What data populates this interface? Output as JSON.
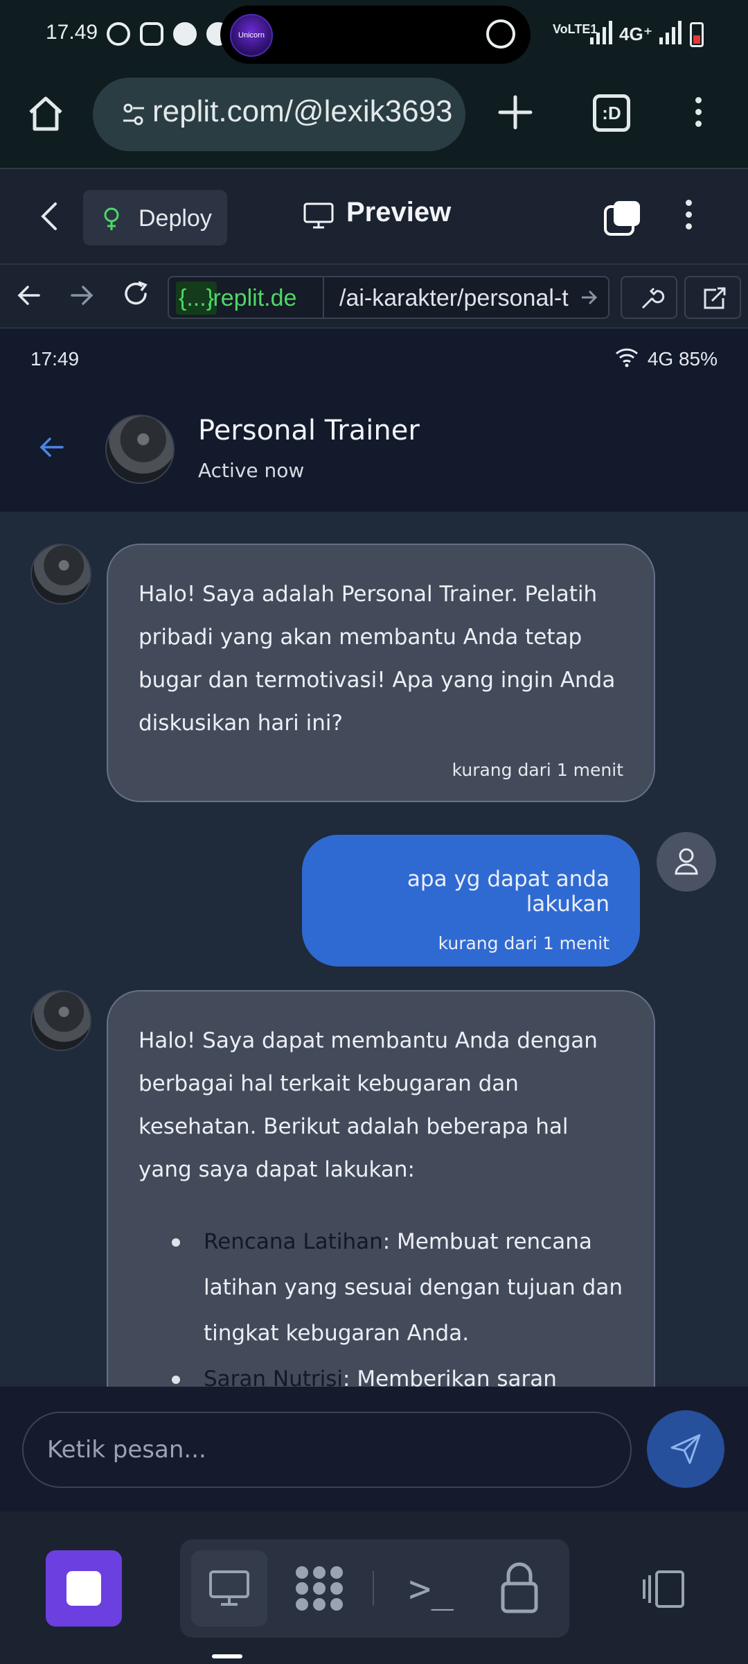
{
  "system": {
    "time": "17.49",
    "network_label": "VoLTE1",
    "network_type": "4G⁺",
    "camera_label": "Unicorn"
  },
  "browser": {
    "url": "replit.com/@lexik3693",
    "tabs_label": ":D"
  },
  "replit": {
    "deploy_label": "Deploy",
    "preview_label": "Preview"
  },
  "webview": {
    "domain_badge": "{...}",
    "domain": ".replit.de",
    "path": "/ai-karakter/personal-t"
  },
  "app_status": {
    "time": "17:49",
    "right": "4G 85%"
  },
  "chat": {
    "title": "Personal Trainer",
    "subtitle": "Active now",
    "messages": [
      {
        "text": "Halo! Saya adalah Personal Trainer. Pelatih pribadi yang akan membantu Anda tetap bugar dan termotivasi! Apa yang ingin Anda diskusikan hari ini?",
        "time": "kurang dari 1 menit"
      },
      {
        "text": "apa yg dapat anda lakukan",
        "time": "kurang dari 1 menit"
      },
      {
        "text": "Halo! Saya dapat membantu Anda dengan berbagai hal terkait kebugaran dan kesehatan. Berikut adalah beberapa hal yang saya dapat lakukan:",
        "list": [
          {
            "key": "Rencana Latihan",
            "text": ": Membuat rencana latihan yang sesuai dengan tujuan dan tingkat kebugaran Anda."
          },
          {
            "key": "Saran Nutrisi",
            "text": ": Memberikan saran"
          }
        ]
      }
    ],
    "input_placeholder": "Ketik pesan..."
  },
  "colors": {
    "accent": "#2f6ad3",
    "bot_bubble": "#434b5a",
    "background": "#1f2a3b",
    "stop": "#6b3fe0"
  }
}
